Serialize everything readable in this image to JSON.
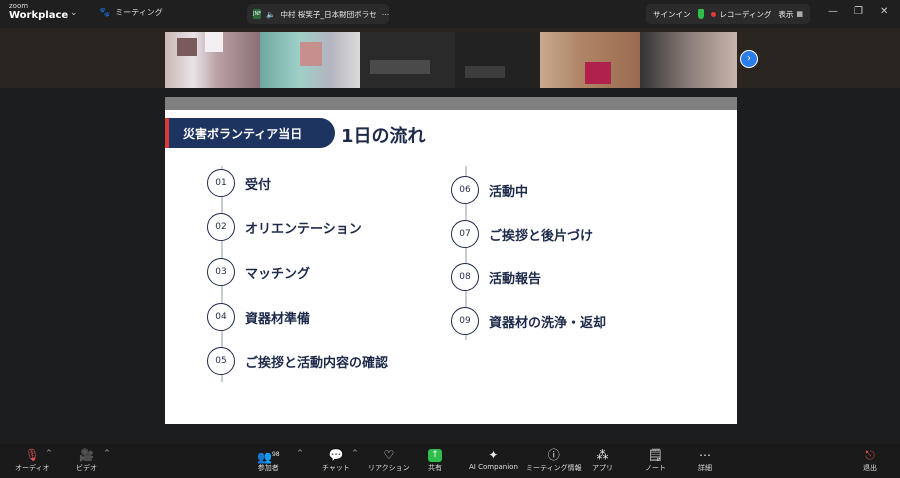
{
  "app": {
    "brand_small": "zoom",
    "brand_main": "Workplace",
    "meeting_tab": "ミーティング",
    "speaker_badge": "JNF",
    "speaker_name": "中村 桜笑子_日本財団ボラセ",
    "signin": "サインイン",
    "recording": "レコーディング",
    "view": "表示"
  },
  "slide": {
    "header_badge": "災害ボランティア当日",
    "title": "1日の流れ",
    "steps_left": [
      {
        "num": "01",
        "label": "受付"
      },
      {
        "num": "02",
        "label": "オリエンテーション"
      },
      {
        "num": "03",
        "label": "マッチング"
      },
      {
        "num": "04",
        "label": "資器材準備"
      },
      {
        "num": "05",
        "label": "ご挨拶と活動内容の確認"
      }
    ],
    "steps_right": [
      {
        "num": "06",
        "label": "活動中"
      },
      {
        "num": "07",
        "label": "ご挨拶と後片づけ"
      },
      {
        "num": "08",
        "label": "活動報告"
      },
      {
        "num": "09",
        "label": "資器材の洗浄・返却"
      }
    ]
  },
  "toolbar": {
    "audio": "オーディオ",
    "video": "ビデオ",
    "participants": "参加者",
    "participants_count": "98",
    "chat": "チャット",
    "reactions": "リアクション",
    "share": "共有",
    "ai": "AI Companion",
    "info": "ミーティング情報",
    "apps": "アプリ",
    "notes": "ノート",
    "more": "詳細",
    "leave": "退出"
  },
  "colors": {
    "slide_navy": "#1d3461",
    "accent_red": "#d83a3a",
    "share_green": "#2fbf4a",
    "nav_blue": "#2b7de9"
  }
}
